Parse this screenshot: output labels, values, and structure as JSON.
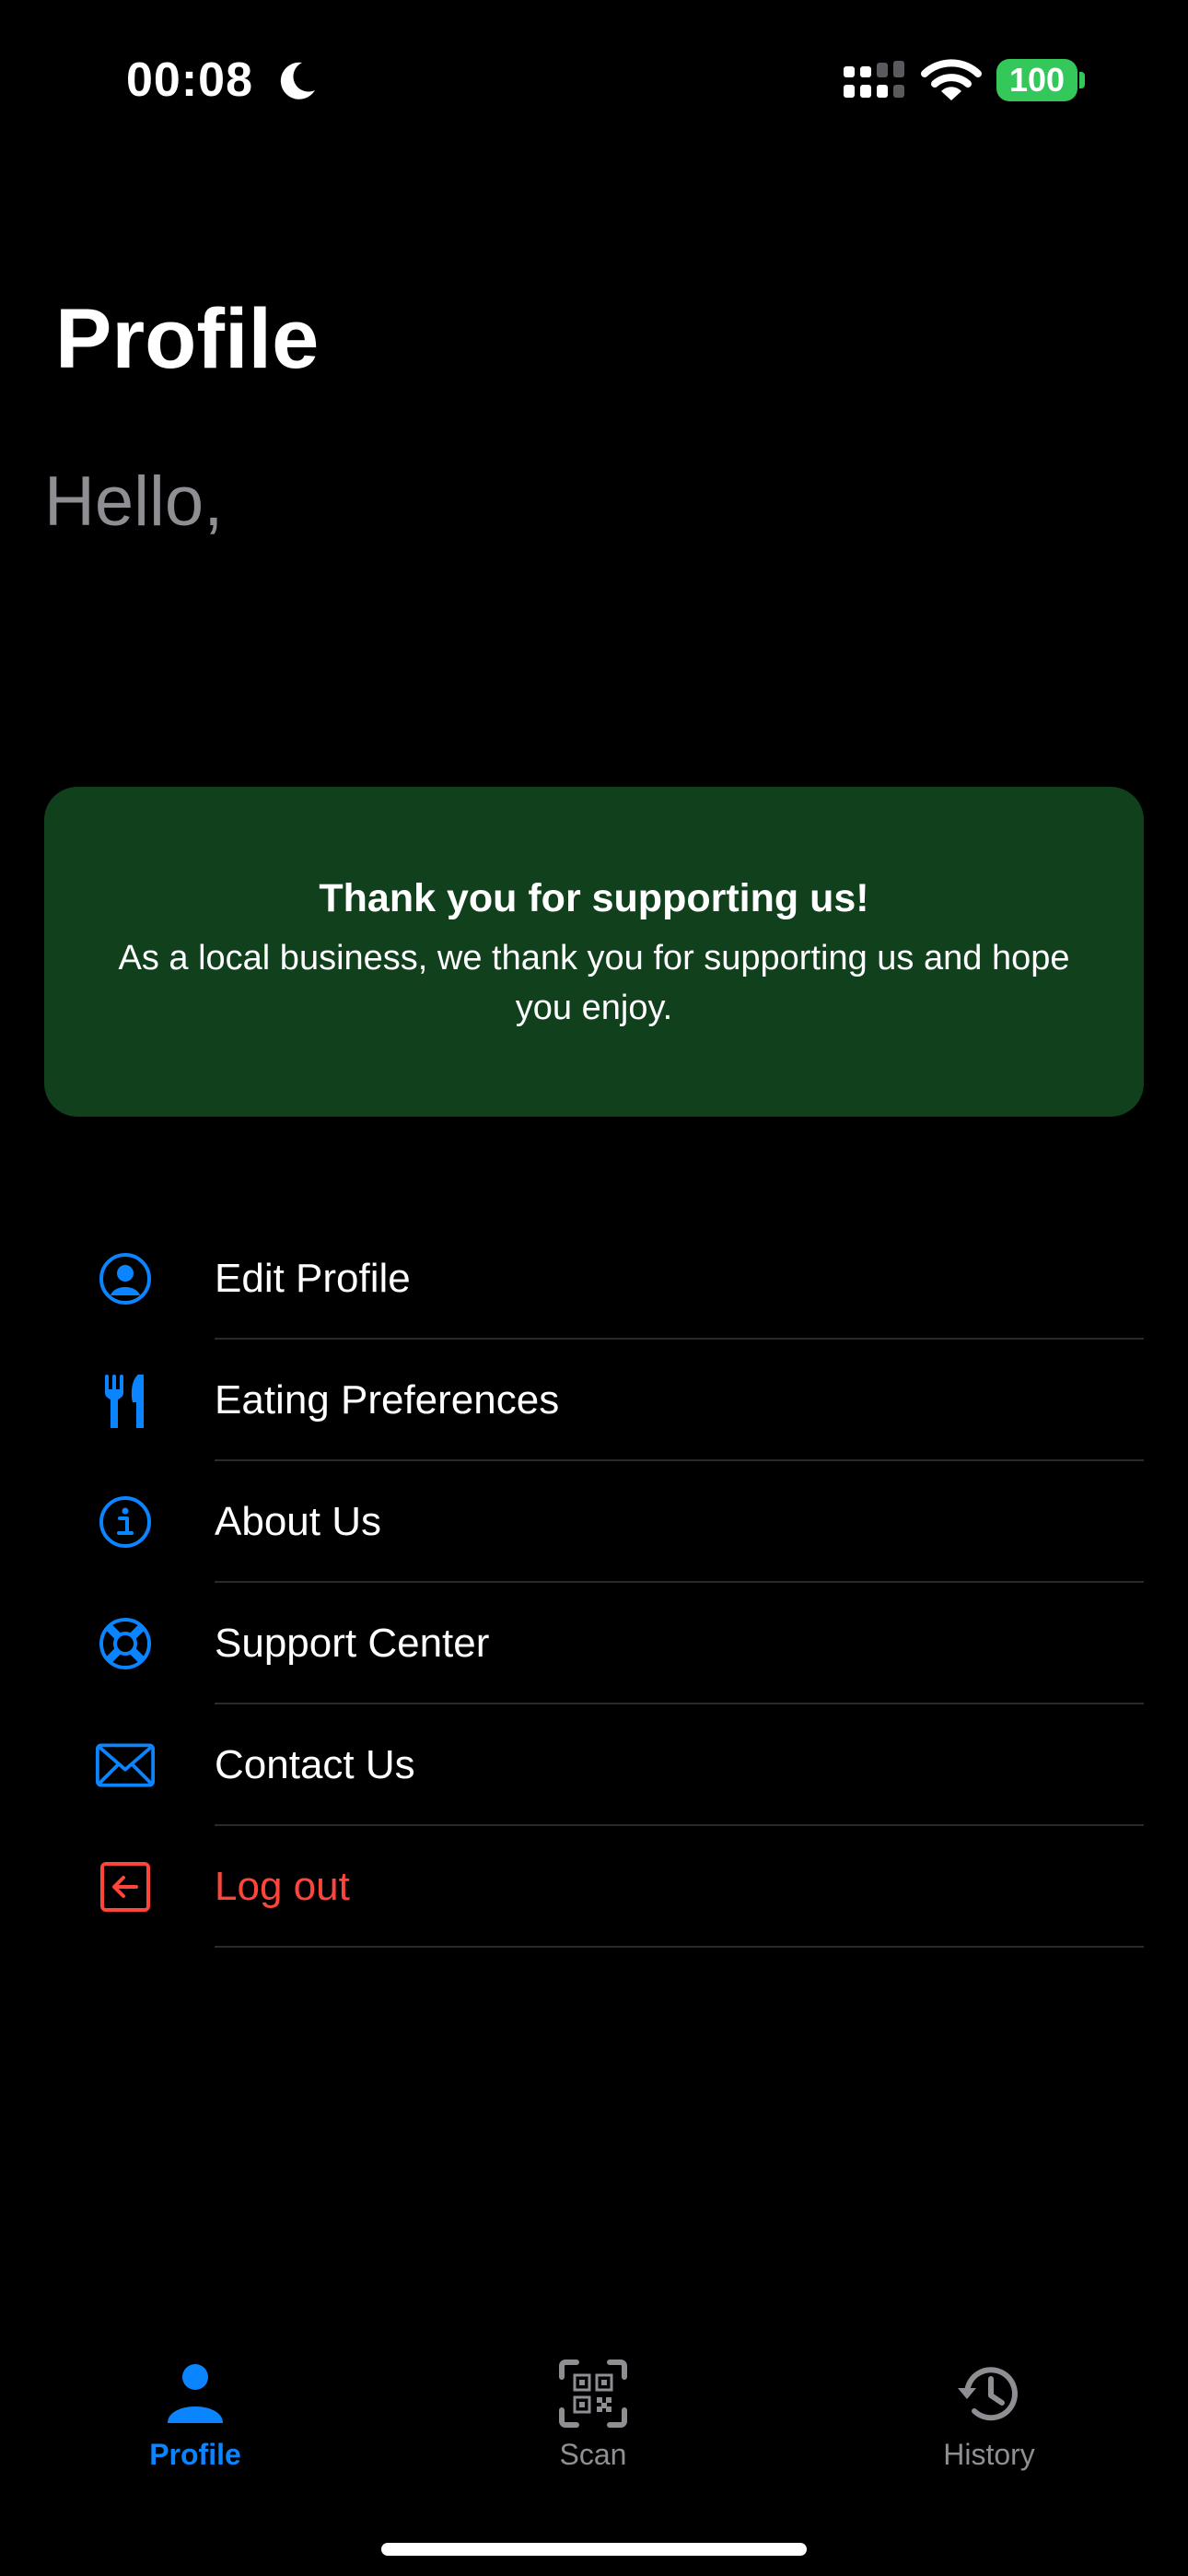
{
  "status_bar": {
    "time": "00:08",
    "battery": "100"
  },
  "header": {
    "title": "Profile",
    "greeting": "Hello,"
  },
  "banner": {
    "title": "Thank you for supporting us!",
    "text": "As a local business, we thank you for supporting us and hope you enjoy."
  },
  "menu": {
    "items": [
      {
        "label": "Edit Profile",
        "icon": "person-circle-icon"
      },
      {
        "label": "Eating Preferences",
        "icon": "fork-knife-icon"
      },
      {
        "label": "About Us",
        "icon": "info-circle-icon"
      },
      {
        "label": "Support Center",
        "icon": "lifebuoy-icon"
      },
      {
        "label": "Contact Us",
        "icon": "envelope-icon"
      },
      {
        "label": "Log out",
        "icon": "logout-icon"
      }
    ]
  },
  "tab_bar": {
    "tabs": [
      {
        "label": "Profile",
        "icon": "person-icon",
        "active": true
      },
      {
        "label": "Scan",
        "icon": "qr-scan-icon",
        "active": false
      },
      {
        "label": "History",
        "icon": "history-icon",
        "active": false
      }
    ]
  },
  "colors": {
    "accent": "#0a84ff",
    "danger": "#ff453a",
    "banner_bg": "#11401d",
    "battery": "#34c759",
    "secondary_text": "#8e8e93"
  }
}
